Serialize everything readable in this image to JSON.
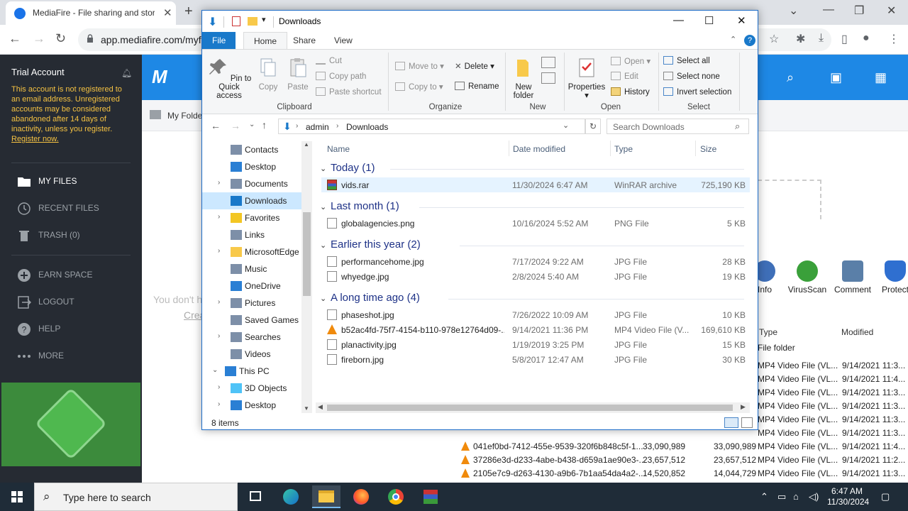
{
  "browser": {
    "tab_title": "MediaFire - File sharing and storage",
    "url": "app.mediafire.com/myfiles",
    "new_tab_symbol": "+",
    "tab_close_symbol": "✕"
  },
  "mediafire": {
    "trial_title": "Trial Account",
    "trial_notice": "This account is not registered to an email address. Unregistered accounts may be considered abandoned after 14 days of inactivity, unless you register.",
    "register_link": "Register now.",
    "nav": [
      {
        "label": "MY FILES",
        "icon": "folder-icon"
      },
      {
        "label": "RECENT FILES",
        "icon": "clock-icon"
      },
      {
        "label": "TRASH (0)",
        "icon": "trash-icon"
      },
      {
        "label": "EARN SPACE",
        "icon": "plus-circle-icon"
      },
      {
        "label": "LOGOUT",
        "icon": "logout-icon"
      },
      {
        "label": "HELP",
        "icon": "help-icon"
      },
      {
        "label": "MORE",
        "icon": "more-icon"
      }
    ],
    "logo_text": "M",
    "breadcrumb": "My Folder",
    "empty_text": "You don't h",
    "empty_link": "Crea",
    "actions": [
      {
        "label": "Info",
        "color": "#3f6fb8"
      },
      {
        "label": "VirusScan",
        "color": "#3aa03a"
      },
      {
        "label": "Comment",
        "color": "#5a7fa8"
      },
      {
        "label": "Protect",
        "color": "#2f6fd0"
      }
    ],
    "list_header": {
      "type": "Type",
      "modified": "Modified"
    },
    "folder_type": "File folder",
    "rows": [
      {
        "name": "",
        "size1": "",
        "size2": "",
        "type": "MP4 Video File (VL...",
        "modified": "9/14/2021 11:3..."
      },
      {
        "name": "",
        "size1": "",
        "size2": "",
        "type": "MP4 Video File (VL...",
        "modified": "9/14/2021 11:4..."
      },
      {
        "name": "",
        "size1": "",
        "size2": "",
        "type": "MP4 Video File (VL...",
        "modified": "9/14/2021 11:3..."
      },
      {
        "name": "",
        "size1": "",
        "size2": "",
        "type": "MP4 Video File (VL...",
        "modified": "9/14/2021 11:3..."
      },
      {
        "name": "",
        "size1": "",
        "size2": "",
        "type": "MP4 Video File (VL...",
        "modified": "9/14/2021 11:3..."
      },
      {
        "name": "",
        "size1": "",
        "size2": "",
        "type": "MP4 Video File (VL...",
        "modified": "9/14/2021 11:3..."
      },
      {
        "name": "041ef0bd-7412-455e-9539-320f6b848c5f-1...",
        "size1": "33,090,989",
        "size2": "33,090,989",
        "type": "MP4 Video File (VL...",
        "modified": "9/14/2021 11:4..."
      },
      {
        "name": "37286e3d-d233-4abe-b438-d659a1ae90e3-...",
        "size1": "23,657,512",
        "size2": "23,657,512",
        "type": "MP4 Video File (VL...",
        "modified": "9/14/2021 11:2..."
      },
      {
        "name": "2105e7c9-d263-4130-a9b6-7b1aa54da4a2-...",
        "size1": "14,520,852",
        "size2": "14,044,729",
        "type": "MP4 Video File (VL...",
        "modified": "9/14/2021 11:3..."
      }
    ]
  },
  "explorer": {
    "title": "Downloads",
    "ribbon_tabs": [
      "File",
      "Home",
      "Share",
      "View"
    ],
    "clipboard": {
      "pin": "Pin to Quick access",
      "copy": "Copy",
      "paste": "Paste",
      "cut": "Cut",
      "copy_path": "Copy path",
      "paste_shortcut": "Paste shortcut",
      "group": "Clipboard"
    },
    "organize": {
      "move_to": "Move to",
      "copy_to": "Copy to",
      "delete": "Delete",
      "rename": "Rename",
      "group": "Organize"
    },
    "new": {
      "new_folder": "New folder",
      "group": "New"
    },
    "open": {
      "properties": "Properties",
      "open": "Open",
      "edit": "Edit",
      "history": "History",
      "group": "Open"
    },
    "select": {
      "select_all": "Select all",
      "select_none": "Select none",
      "invert": "Invert selection",
      "group": "Select"
    },
    "address": {
      "segments": [
        "admin",
        "Downloads"
      ]
    },
    "search_placeholder": "Search Downloads",
    "nav_items": [
      {
        "label": "Contacts",
        "expand": false,
        "indent": 1,
        "icon": "contacts-icon"
      },
      {
        "label": "Desktop",
        "expand": false,
        "indent": 1,
        "icon": "desktop-icon"
      },
      {
        "label": "Documents",
        "expand": true,
        "indent": 1,
        "icon": "documents-icon"
      },
      {
        "label": "Downloads",
        "expand": false,
        "indent": 1,
        "icon": "downloads-icon",
        "selected": true
      },
      {
        "label": "Favorites",
        "expand": true,
        "indent": 1,
        "icon": "star-icon"
      },
      {
        "label": "Links",
        "expand": false,
        "indent": 1,
        "icon": "links-icon"
      },
      {
        "label": "MicrosoftEdge",
        "expand": true,
        "indent": 1,
        "icon": "folder-icon"
      },
      {
        "label": "Music",
        "expand": false,
        "indent": 1,
        "icon": "music-icon"
      },
      {
        "label": "OneDrive",
        "expand": false,
        "indent": 1,
        "icon": "cloud-icon"
      },
      {
        "label": "Pictures",
        "expand": true,
        "indent": 1,
        "icon": "pictures-icon"
      },
      {
        "label": "Saved Games",
        "expand": false,
        "indent": 1,
        "icon": "games-icon"
      },
      {
        "label": "Searches",
        "expand": true,
        "indent": 1,
        "icon": "search-icon"
      },
      {
        "label": "Videos",
        "expand": false,
        "indent": 1,
        "icon": "videos-icon"
      },
      {
        "label": "This PC",
        "expand": "open",
        "indent": 0,
        "icon": "pc-icon"
      },
      {
        "label": "3D Objects",
        "expand": true,
        "indent": 1,
        "icon": "cube-icon"
      },
      {
        "label": "Desktop",
        "expand": true,
        "indent": 1,
        "icon": "desktop-icon"
      }
    ],
    "columns": {
      "name": "Name",
      "date": "Date modified",
      "type": "Type",
      "size": "Size"
    },
    "groups": [
      {
        "label": "Today (1)",
        "files": [
          {
            "name": "vids.rar",
            "date": "11/30/2024 6:47 AM",
            "type": "WinRAR archive",
            "size": "725,190 KB",
            "icon": "rar",
            "selected": true
          }
        ]
      },
      {
        "label": "Last month (1)",
        "files": [
          {
            "name": "globalagencies.png",
            "date": "10/16/2024 5:52 AM",
            "type": "PNG File",
            "size": "5 KB",
            "icon": "doc"
          }
        ]
      },
      {
        "label": "Earlier this year (2)",
        "files": [
          {
            "name": "performancehome.jpg",
            "date": "7/17/2024 9:22 AM",
            "type": "JPG File",
            "size": "28 KB",
            "icon": "doc"
          },
          {
            "name": "whyedge.jpg",
            "date": "2/8/2024 5:40 AM",
            "type": "JPG File",
            "size": "19 KB",
            "icon": "doc"
          }
        ]
      },
      {
        "label": "A long time ago (4)",
        "files": [
          {
            "name": "phaseshot.jpg",
            "date": "7/26/2022 10:09 AM",
            "type": "JPG File",
            "size": "10 KB",
            "icon": "doc"
          },
          {
            "name": "b52ac4fd-75f7-4154-b110-978e12764d09-...",
            "date": "9/14/2021 11:36 PM",
            "type": "MP4 Video File (V...",
            "size": "169,610 KB",
            "icon": "vlc"
          },
          {
            "name": "planactivity.jpg",
            "date": "1/19/2019 3:25 PM",
            "type": "JPG File",
            "size": "15 KB",
            "icon": "doc"
          },
          {
            "name": "fireborn.jpg",
            "date": "5/8/2017 12:47 AM",
            "type": "JPG File",
            "size": "30 KB",
            "icon": "doc"
          }
        ]
      }
    ],
    "status": "8 items"
  },
  "taskbar": {
    "search_placeholder": "Type here to search",
    "time": "6:47 AM",
    "date": "11/30/2024",
    "apps": [
      "task-view-icon",
      "edge-icon",
      "file-explorer-icon",
      "firefox-icon",
      "chrome-icon",
      "winrar-icon"
    ]
  }
}
